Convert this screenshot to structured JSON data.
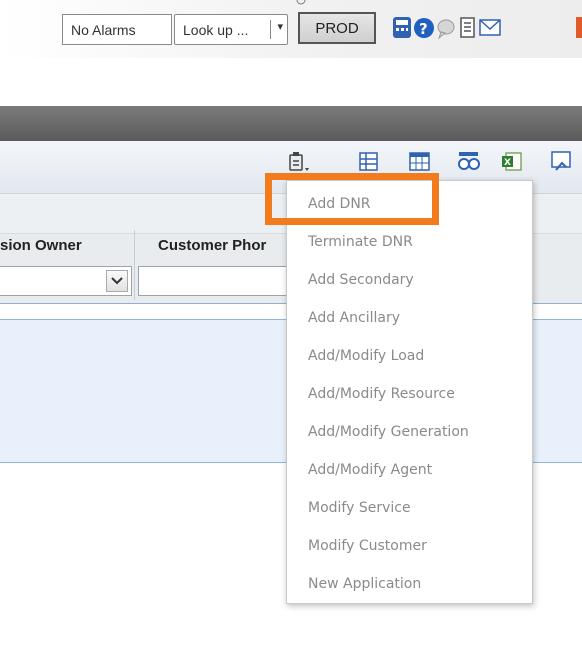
{
  "topbar": {
    "alarms_label": "No Alarms",
    "lookup_label": "Look up ...",
    "lookup_arrow": "▾",
    "env_label": "PROD",
    "icons": [
      "calculator-icon",
      "help-icon",
      "chat-icon",
      "report-icon",
      "mail-icon"
    ]
  },
  "toolbar": {
    "icons": [
      "clipboard-menu-icon",
      "grid-list-icon",
      "table-icon",
      "binoculars-icon",
      "excel-export-icon",
      "refresh-icon"
    ]
  },
  "grid": {
    "columns": [
      "sion Owner",
      "Customer Phor"
    ],
    "filter_dropdown_arrow": "⌄"
  },
  "menu": {
    "items": [
      "Add DNR",
      "Terminate DNR",
      "Add Secondary",
      "Add Ancillary",
      "Add/Modify Load",
      "Add/Modify Resource",
      "Add/Modify Generation",
      "Add/Modify Agent",
      "Modify Service",
      "Modify Customer",
      "New Application"
    ]
  },
  "colors": {
    "highlight": "#f27c1d",
    "menu_text": "#8a8a8a",
    "dark_band": "#5b5b5b",
    "selection": "#e8f1fb"
  }
}
